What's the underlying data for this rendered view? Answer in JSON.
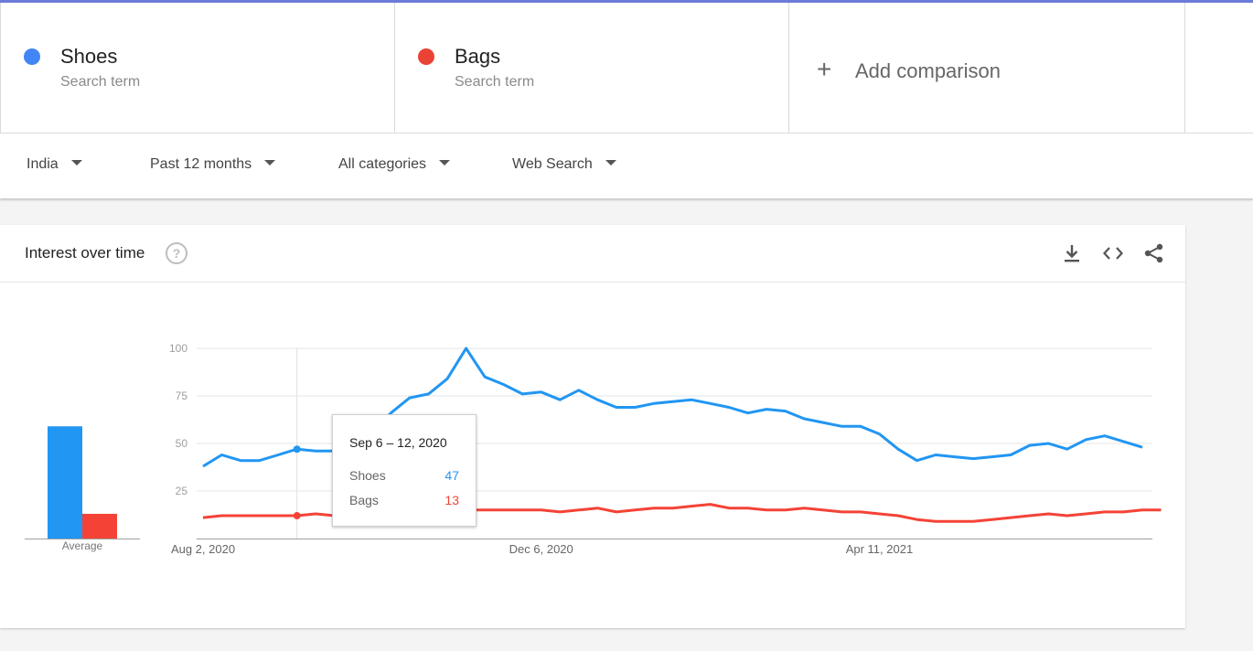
{
  "terms": [
    {
      "name": "Shoes",
      "subtitle": "Search term",
      "color": "#4285f4"
    },
    {
      "name": "Bags",
      "subtitle": "Search term",
      "color": "#ea4335"
    }
  ],
  "add_comparison": {
    "label": "Add comparison",
    "icon": "plus-icon"
  },
  "filters": {
    "region": "India",
    "time": "Past 12 months",
    "category": "All categories",
    "property": "Web Search"
  },
  "card": {
    "title": "Interest over time",
    "icons": [
      "help-icon",
      "download-icon",
      "embed-icon",
      "share-icon"
    ]
  },
  "tooltip": {
    "date": "Sep 6 – 12, 2020",
    "rows": [
      {
        "label": "Shoes",
        "value": "47"
      },
      {
        "label": "Bags",
        "value": "13"
      }
    ]
  },
  "chart_data": {
    "type": "line",
    "ylim": [
      0,
      100
    ],
    "y_ticks": [
      "100",
      "75",
      "50",
      "25"
    ],
    "x_tick_labels": [
      "Aug 2, 2020",
      "Dec 6, 2020",
      "Apr 11, 2021"
    ],
    "x_tick_indices": [
      0,
      18,
      36
    ],
    "grid": true,
    "series": [
      {
        "name": "Shoes",
        "color": "#2196f3",
        "values": [
          38,
          44,
          41,
          41,
          44,
          47,
          46,
          46,
          48,
          56,
          66,
          74,
          76,
          84,
          100,
          85,
          81,
          76,
          77,
          73,
          78,
          73,
          69,
          69,
          71,
          72,
          73,
          71,
          69,
          66,
          68,
          67,
          63,
          61,
          59,
          59,
          55,
          47,
          41,
          44,
          43,
          42,
          43,
          44,
          49,
          50,
          47,
          52,
          54,
          51,
          48
        ]
      },
      {
        "name": "Bags",
        "color": "#f44336",
        "values": [
          11,
          12,
          12,
          12,
          12,
          12,
          13,
          12,
          12,
          13,
          14,
          14,
          15,
          15,
          15,
          15,
          15,
          15,
          15,
          14,
          15,
          16,
          14,
          15,
          16,
          16,
          17,
          18,
          16,
          16,
          15,
          15,
          16,
          15,
          14,
          14,
          13,
          12,
          10,
          9,
          9,
          9,
          10,
          11,
          12,
          13,
          12,
          13,
          14,
          14,
          15,
          15
        ]
      }
    ],
    "averages": {
      "label": "Average",
      "values": [
        59,
        13
      ]
    }
  }
}
